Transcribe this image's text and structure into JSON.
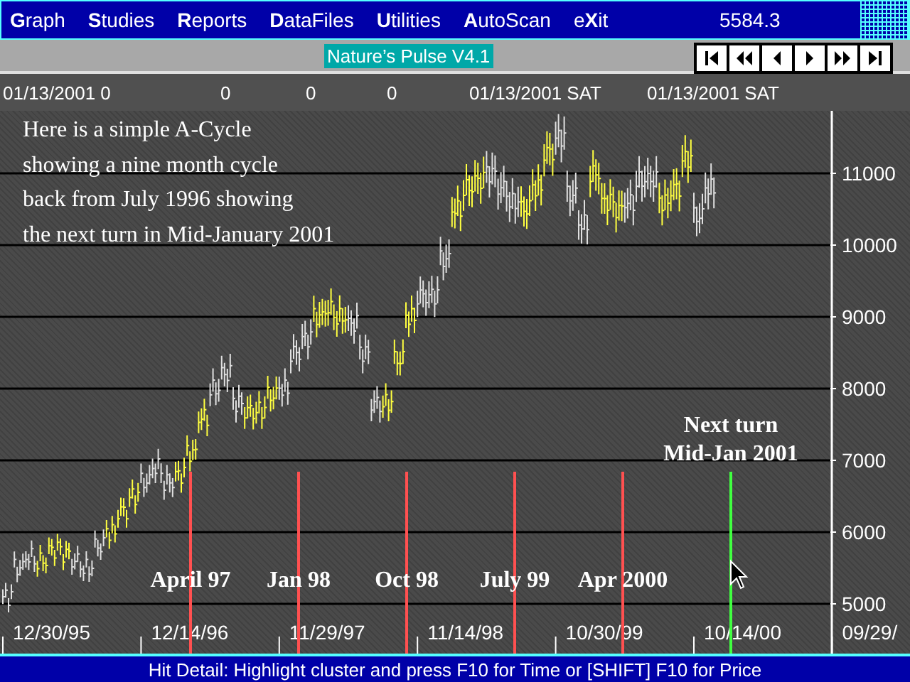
{
  "menu_bar": {
    "items": [
      "**G**raph",
      "**S**tudies",
      "**R**eports",
      "**D**ataFiles",
      "**U**tilities",
      "**A**utoScan",
      "e**X**it"
    ],
    "reading": "5584.3"
  },
  "title_bar": {
    "title": "Nature’s Pulse V4.1",
    "nav_buttons": [
      {
        "kind": "first"
      },
      {
        "kind": "fast-back"
      },
      {
        "kind": "back"
      },
      {
        "kind": "forward"
      },
      {
        "kind": "fast-forward"
      },
      {
        "kind": "last"
      }
    ]
  },
  "info_row": [
    "01/13/2001 0",
    "0",
    "0",
    "0",
    "01/13/2001 SAT",
    "01/13/2001 SAT"
  ],
  "note": [
    "Here is a simple A-Cycle",
    "showing a nine month cycle",
    "back from July 1996 showing",
    "the next turn in Mid-January 2001"
  ],
  "chart": {
    "y_axis_labels": [
      "11000",
      "10000",
      "9000",
      "8000",
      "7000",
      "6000",
      "5000"
    ],
    "x_axis_labels": [
      "12/30/95",
      "12/14/96",
      "11/29/97",
      "11/14/98",
      "10/30/99",
      "10/14/00",
      "09/29/"
    ],
    "cycle_markers": [
      {
        "kind": "past",
        "label": "April 97",
        "color": "#ff5050"
      },
      {
        "kind": "past",
        "label": "Jan 98",
        "color": "#ff5050"
      },
      {
        "kind": "past",
        "label": "Oct 98",
        "color": "#ff5050"
      },
      {
        "kind": "past",
        "label": "July 99",
        "color": "#ff5050"
      },
      {
        "kind": "past",
        "label": "Apr 2000",
        "color": "#ff5050"
      },
      {
        "kind": "next",
        "label": "Next turn",
        "label_2": "Mid-Jan 2001",
        "color": "#40ff40"
      }
    ]
  },
  "status_bar": "Hit Detail: Highlight cluster and press F10 for Time or [SHIFT] F10 for Price"
}
